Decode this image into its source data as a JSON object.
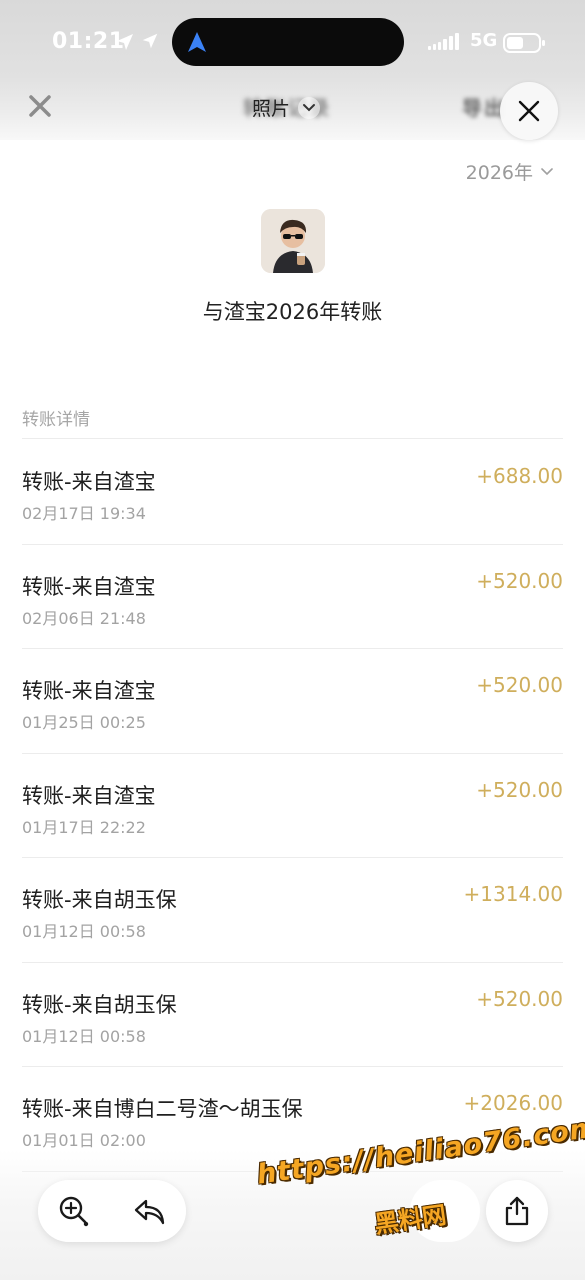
{
  "status_bar": {
    "time": "01:21",
    "network": "5G"
  },
  "nav": {
    "title_blurred": "转账记录",
    "photo_menu_label": "照片",
    "export_blurred": "导出"
  },
  "year_filter": {
    "label": "2026年"
  },
  "summary": {
    "title": "与渣宝2026年转账"
  },
  "section": {
    "label": "转账详情"
  },
  "transactions": [
    {
      "title": "转账-来自渣宝",
      "time": "02月17日 19:34",
      "amount": "+688.00"
    },
    {
      "title": "转账-来自渣宝",
      "time": "02月06日 21:48",
      "amount": "+520.00"
    },
    {
      "title": "转账-来自渣宝",
      "time": "01月25日 00:25",
      "amount": "+520.00"
    },
    {
      "title": "转账-来自渣宝",
      "time": "01月17日 22:22",
      "amount": "+520.00"
    },
    {
      "title": "转账-来自胡玉保",
      "time": "01月12日 00:58",
      "amount": "+1314.00"
    },
    {
      "title": "转账-来自胡玉保",
      "time": "01月12日 00:58",
      "amount": "+520.00"
    },
    {
      "title": "转账-来自博白二号渣～胡玉保",
      "time": "01月01日 02:00",
      "amount": "+2026.00"
    }
  ],
  "watermark": {
    "url": "https://heiliao76.com",
    "name": "黑料网"
  },
  "icons": {
    "close": "close-icon",
    "chevron": "chevron-down-icon",
    "zoom": "zoom-in-icon",
    "back": "back-arrow-icon",
    "share": "share-icon"
  },
  "colors": {
    "amount": "#cfae5c",
    "watermark": "#f5a623"
  }
}
